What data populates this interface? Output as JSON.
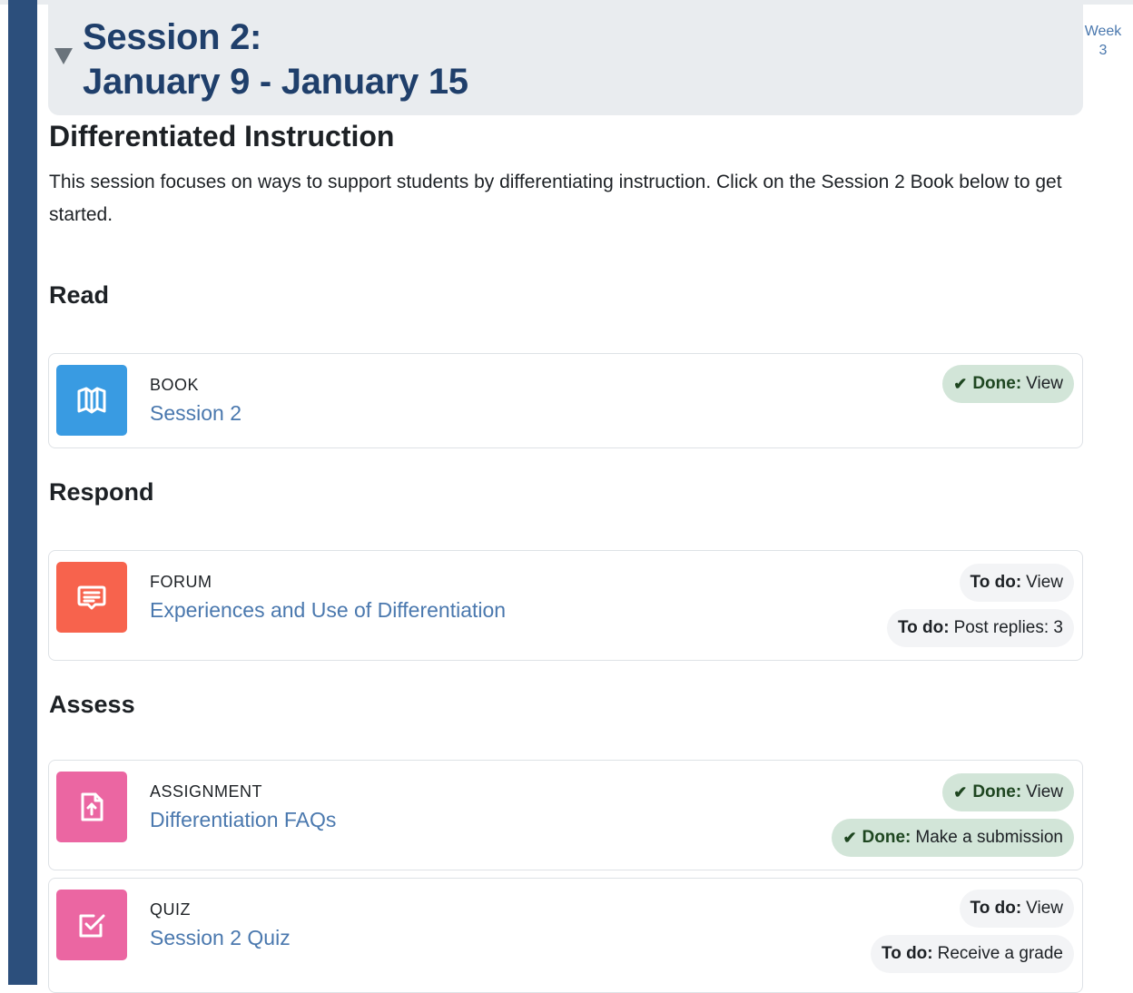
{
  "section": {
    "title_line1": "Session 2:",
    "title_line2": "January 9 - January 15",
    "week_word": "Week",
    "week_num": "3"
  },
  "content": {
    "title": "Differentiated Instruction",
    "summary": "This session focuses on ways to support students by differentiating instruction. Click on the Session 2 Book below to get started."
  },
  "subheadings": {
    "read": "Read",
    "respond": "Respond",
    "assess": "Assess"
  },
  "activities": [
    {
      "type": "BOOK",
      "name": "Session 2",
      "icon": "book-icon",
      "color": "#399be2",
      "badges": [
        {
          "status": "Done:",
          "text": "View",
          "done": true
        }
      ]
    },
    {
      "type": "FORUM",
      "name": "Experiences and Use of Differentiation",
      "icon": "forum-icon",
      "color": "#f7634d",
      "badges": [
        {
          "status": "To do:",
          "text": "View",
          "done": false
        },
        {
          "status": "To do:",
          "text": "Post replies: 3",
          "done": false
        }
      ]
    },
    {
      "type": "ASSIGNMENT",
      "name": "Differentiation FAQs",
      "icon": "assignment-upload-icon",
      "color": "#eb66a2",
      "badges": [
        {
          "status": "Done:",
          "text": "View",
          "done": true
        },
        {
          "status": "Done:",
          "text": "Make a submission",
          "done": true
        }
      ]
    },
    {
      "type": "QUIZ",
      "name": "Session 2 Quiz",
      "icon": "quiz-checkbox-icon",
      "color": "#eb66a2",
      "badges": [
        {
          "status": "To do:",
          "text": "View",
          "done": false
        },
        {
          "status": "To do:",
          "text": "Receive a grade",
          "done": false
        }
      ]
    }
  ]
}
